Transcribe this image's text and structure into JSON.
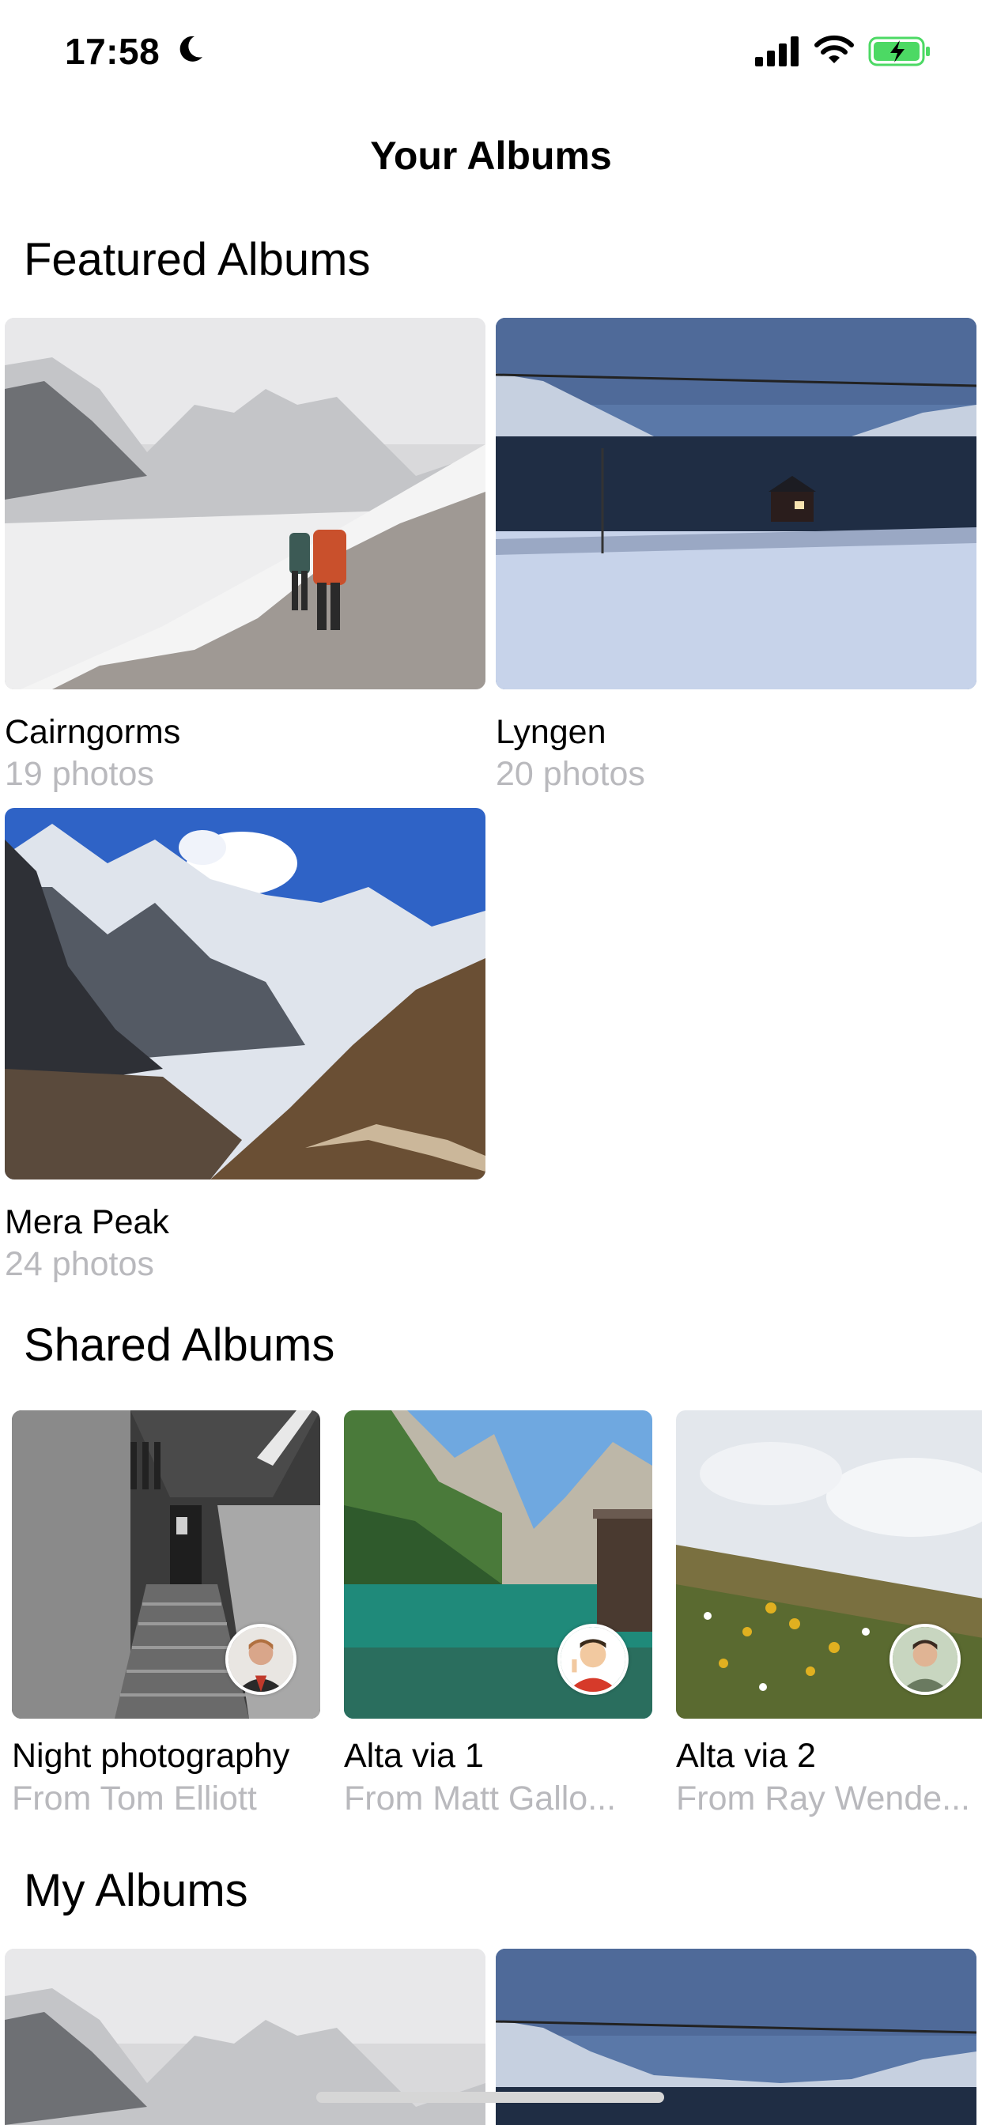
{
  "status_bar": {
    "time": "17:58",
    "icons": [
      "moon-icon",
      "cellular-signal-icon",
      "wifi-icon",
      "battery-charging-icon"
    ],
    "battery_color": "#4cd964"
  },
  "nav": {
    "title": "Your Albums"
  },
  "featured": {
    "title": "Featured Albums",
    "albums": [
      {
        "name": "Cairngorms",
        "count": "19 photos"
      },
      {
        "name": "Lyngen",
        "count": "20 photos"
      },
      {
        "name": "Mera Peak",
        "count": "24 photos"
      }
    ]
  },
  "shared": {
    "title": "Shared Albums",
    "albums": [
      {
        "name": "Night photography",
        "from": "From Tom Elliott"
      },
      {
        "name": "Alta via 1",
        "from": "From Matt Gallo..."
      },
      {
        "name": "Alta via 2",
        "from": "From Ray Wende..."
      }
    ]
  },
  "mine": {
    "title": "My Albums"
  },
  "colors": {
    "secondary_text": "#b9b9bd"
  }
}
